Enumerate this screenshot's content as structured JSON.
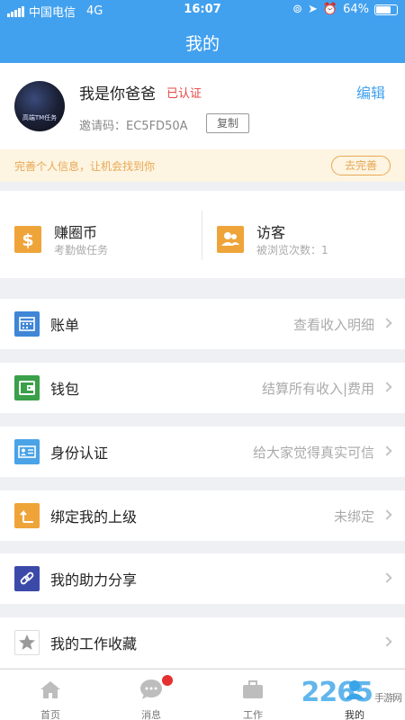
{
  "status_bar": {
    "carrier": "中国电信",
    "network": "4G",
    "time": "16:07",
    "battery": "64%"
  },
  "header": {
    "title": "我的",
    "background": "#42a1ef"
  },
  "profile": {
    "avatar_text": "高端TM任务",
    "nickname": "我是你爸爸",
    "verified": "已认证",
    "edit": "编辑",
    "invite_label": "邀请码：",
    "invite_code": "EC5FD50A",
    "copy": "复制"
  },
  "banner": {
    "text": "完善个人信息，让机会找到你",
    "button": "去完善"
  },
  "stats": [
    {
      "title": "赚圈币",
      "subtitle": "考勤做任务",
      "icon": "dollar-icon"
    },
    {
      "title": "访客",
      "subtitle": "被浏览次数：1",
      "icon": "users-icon"
    }
  ],
  "menu": [
    {
      "label": "账单",
      "desc": "查看收入明细",
      "icon": "calendar-icon",
      "color": "#3f86d6"
    },
    {
      "label": "钱包",
      "desc": "结算所有收入|费用",
      "icon": "wallet-icon",
      "color": "#3aa04a"
    },
    {
      "label": "身份认证",
      "desc": "给大家觉得真实可信",
      "icon": "id-card-icon",
      "color": "#4aa3e6"
    },
    {
      "label": "绑定我的上级",
      "desc": "未绑定",
      "icon": "arrow-up-icon",
      "color": "#efa43a"
    },
    {
      "label": "我的助力分享",
      "desc": "",
      "icon": "link-icon",
      "color": "#3b4aa8"
    },
    {
      "label": "我的工作收藏",
      "desc": "",
      "icon": "star-icon",
      "color": "#9a9a9a"
    }
  ],
  "tabs": [
    {
      "label": "首页",
      "icon": "home-icon"
    },
    {
      "label": "消息",
      "icon": "chat-icon"
    },
    {
      "label": "工作",
      "icon": "briefcase-icon"
    },
    {
      "label": "我的",
      "icon": "user-icon"
    }
  ],
  "watermark": {
    "text": "2265",
    "sub": "手游网"
  }
}
